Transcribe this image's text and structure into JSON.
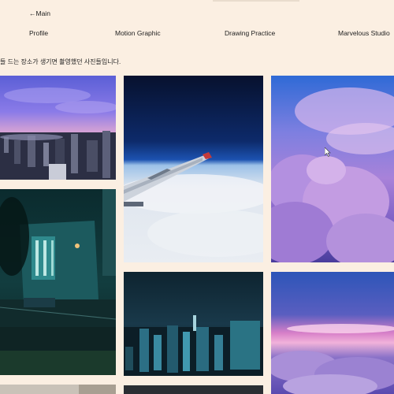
{
  "header": {
    "back_label": "←Main"
  },
  "nav": {
    "items": [
      {
        "label": "Profile"
      },
      {
        "label": "Motion Graphic"
      },
      {
        "label": "Drawing Practice"
      },
      {
        "label": "Marvelous Studio"
      }
    ]
  },
  "intro_text": "들 드는 장소가 생기면 촬영했던 사진들입니다.",
  "gallery": {
    "photos": [
      {
        "subject": "purple-sky-city-skyline"
      },
      {
        "subject": "airplane-wing-above-clouds"
      },
      {
        "subject": "purple-cumulus-clouds"
      },
      {
        "subject": "teal-night-street-building"
      },
      {
        "subject": "night-city-aerial"
      },
      {
        "subject": "pink-sunset-clouds"
      },
      {
        "subject": "partial-photo"
      },
      {
        "subject": "partial-photo"
      }
    ]
  },
  "colors": {
    "background": "#fbefe2",
    "text": "#222222"
  }
}
